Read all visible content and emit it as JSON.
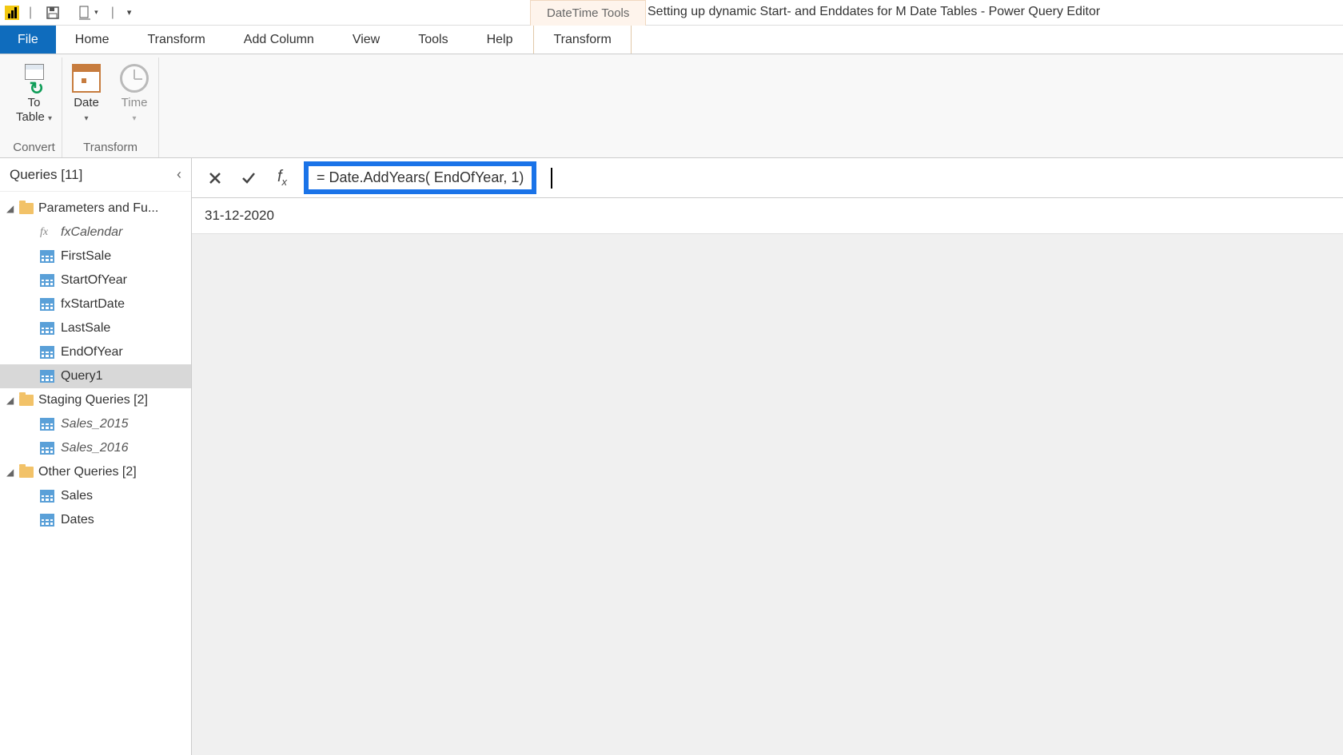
{
  "titlebar": {
    "contextual_header": "DateTime Tools",
    "window_title": "Setting up dynamic Start- and Enddates for M Date Tables - Power Query Editor"
  },
  "tabs": {
    "file": "File",
    "items": [
      "Home",
      "Transform",
      "Add Column",
      "View",
      "Tools",
      "Help"
    ],
    "contextual": "Transform"
  },
  "ribbon": {
    "groups": [
      {
        "label": "Convert",
        "buttons": [
          {
            "label": "To\nTable",
            "has_dropdown": true,
            "icon": "totable"
          }
        ]
      },
      {
        "label": "Transform",
        "buttons": [
          {
            "label": "Date",
            "has_dropdown": true,
            "icon": "date"
          },
          {
            "label": "Time",
            "has_dropdown": true,
            "icon": "time"
          }
        ]
      }
    ]
  },
  "queries": {
    "header": "Queries [11]",
    "groups": [
      {
        "label": "Parameters and Fu...",
        "items": [
          {
            "label": "fxCalendar",
            "icon": "fx",
            "italic": true
          },
          {
            "label": "FirstSale",
            "icon": "table"
          },
          {
            "label": "StartOfYear",
            "icon": "table"
          },
          {
            "label": "fxStartDate",
            "icon": "table"
          },
          {
            "label": "LastSale",
            "icon": "table"
          },
          {
            "label": "EndOfYear",
            "icon": "table"
          },
          {
            "label": "Query1",
            "icon": "table",
            "selected": true
          }
        ]
      },
      {
        "label": "Staging Queries [2]",
        "items": [
          {
            "label": "Sales_2015",
            "icon": "table",
            "italic": true
          },
          {
            "label": "Sales_2016",
            "icon": "table",
            "italic": true
          }
        ]
      },
      {
        "label": "Other Queries [2]",
        "items": [
          {
            "label": "Sales",
            "icon": "table"
          },
          {
            "label": "Dates",
            "icon": "table"
          }
        ]
      }
    ]
  },
  "formula_bar": {
    "formula": "= Date.AddYears( EndOfYear, 1)"
  },
  "result": {
    "value": "31-12-2020"
  }
}
